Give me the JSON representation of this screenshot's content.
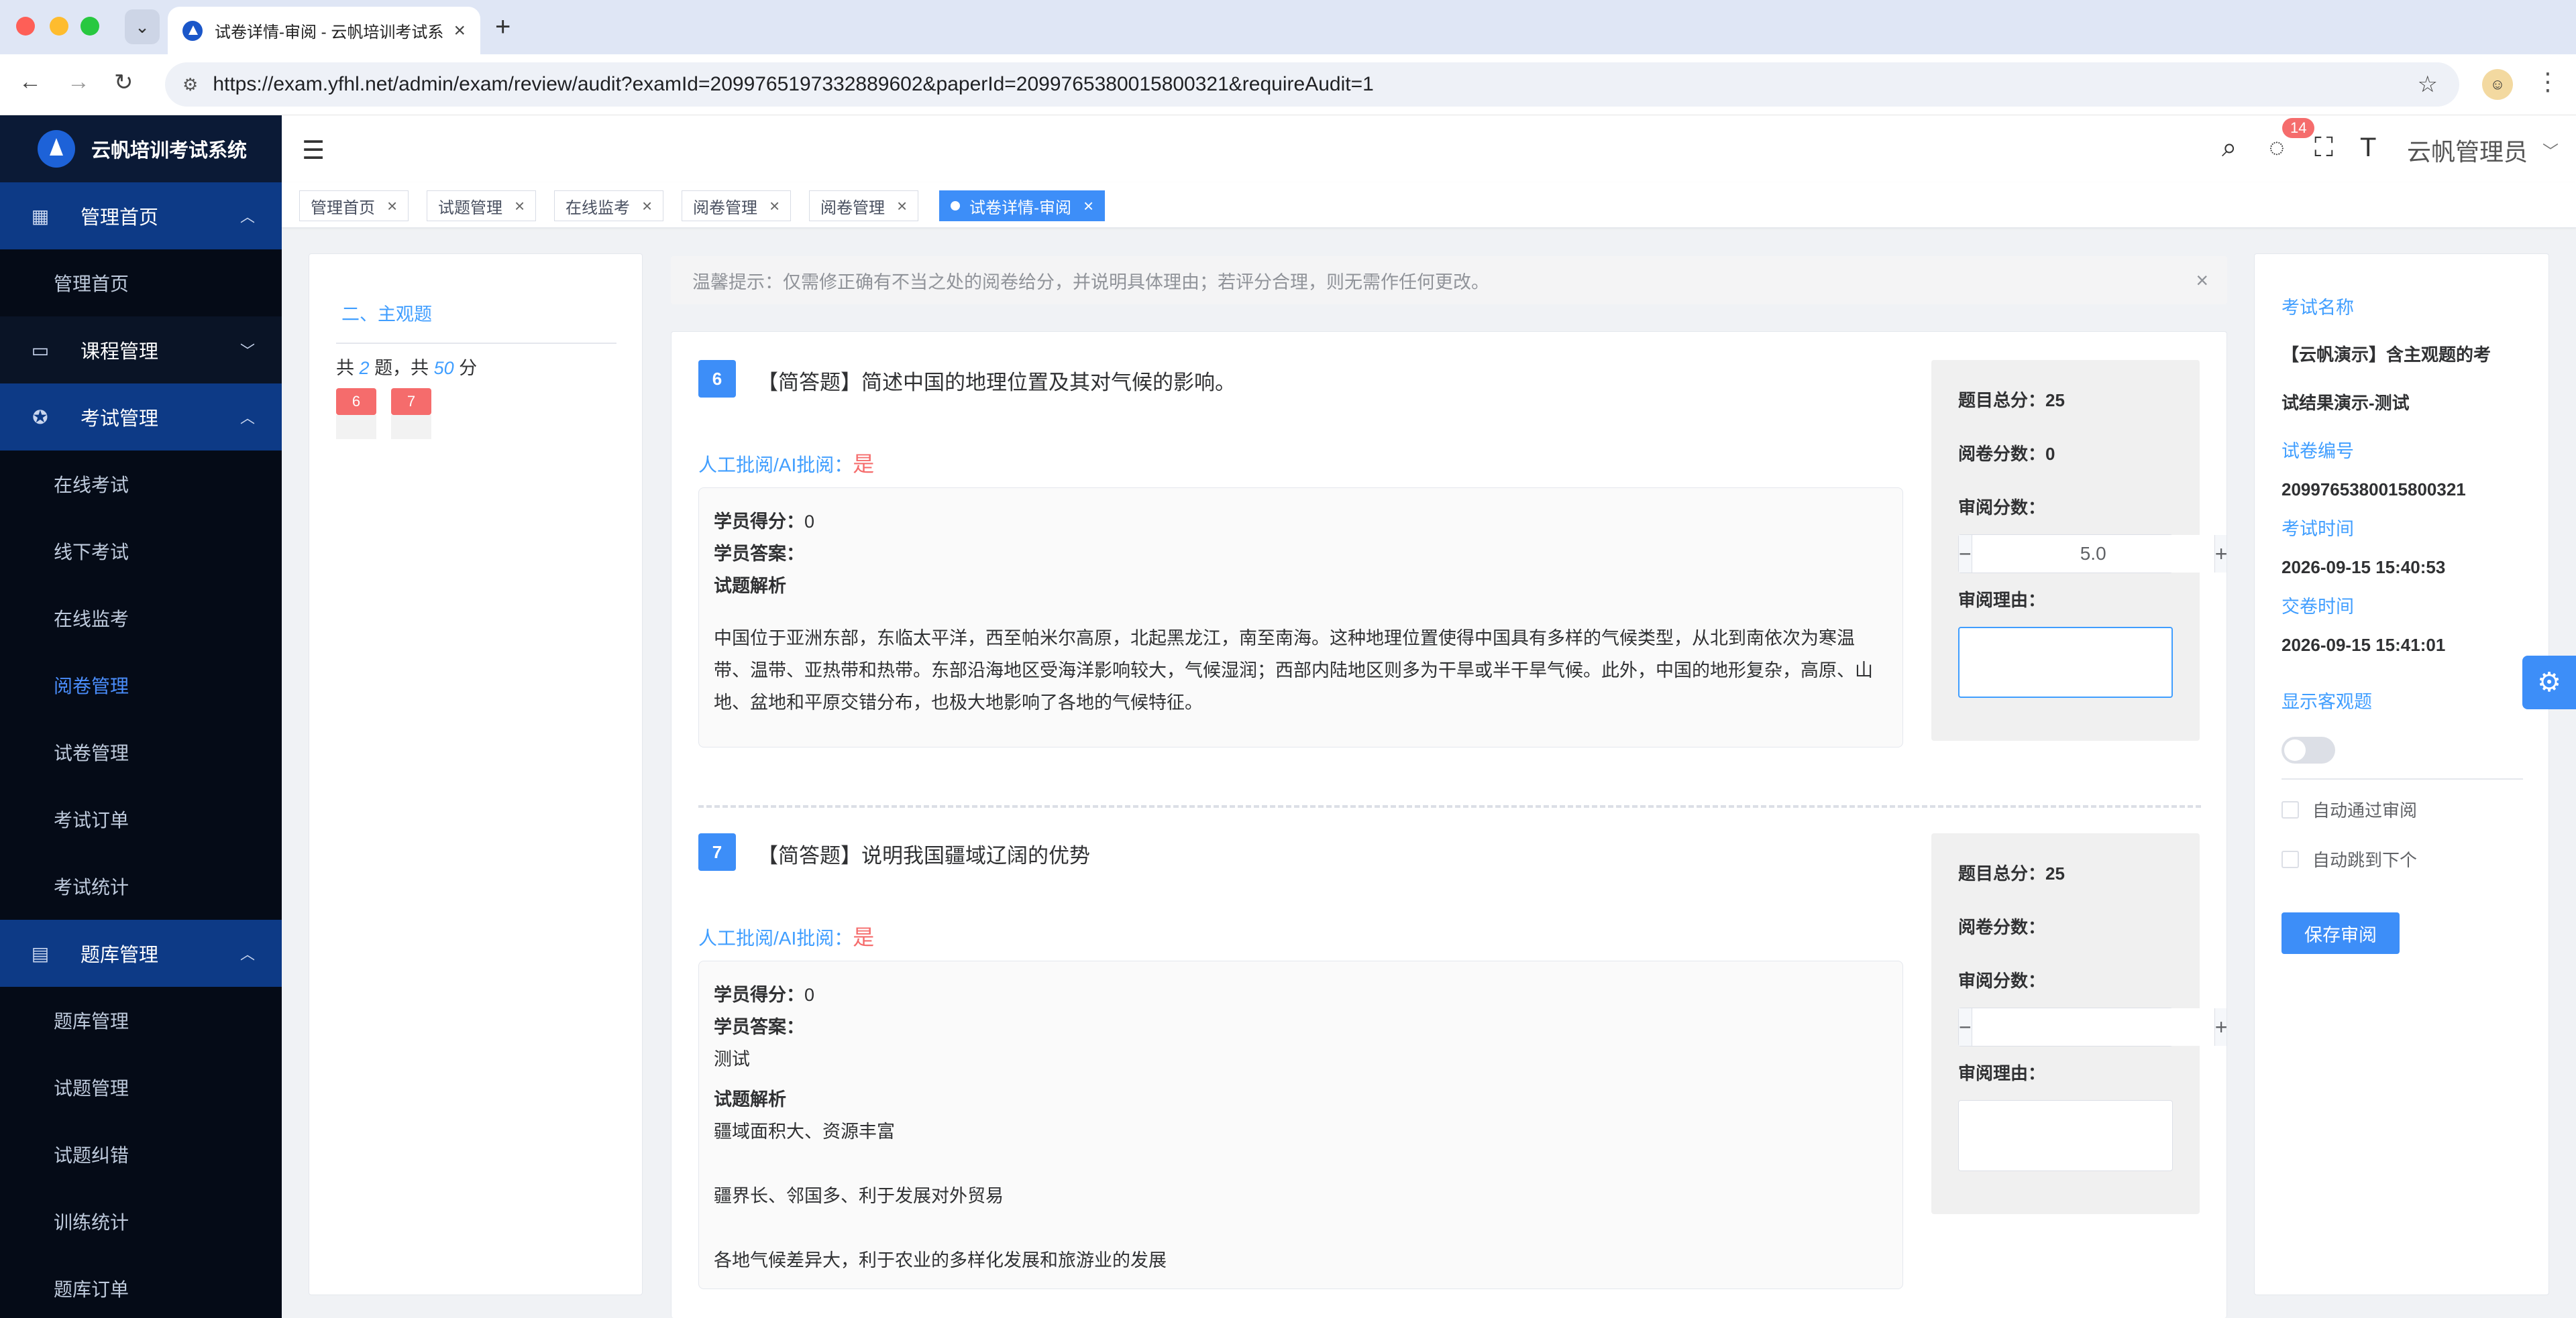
{
  "browser": {
    "tab_title": "试卷详情-审阅 - 云帆培训考试系",
    "url": "https://exam.yfhl.net/admin/exam/review/audit?examId=2099765197332889602&paperId=2099765380015800321&requireAudit=1"
  },
  "sidebar": {
    "logo_text": "云帆培训考试系统",
    "groups": [
      {
        "label": "管理首页",
        "items": [
          "管理首页"
        ]
      },
      {
        "label": "课程管理",
        "items": []
      },
      {
        "label": "考试管理",
        "items": [
          "在线考试",
          "线下考试",
          "在线监考",
          "阅卷管理",
          "试卷管理",
          "考试订单",
          "考试统计"
        ]
      },
      {
        "label": "题库管理",
        "items": [
          "题库管理",
          "试题管理",
          "试题纠错",
          "训练统计",
          "题库订单"
        ]
      }
    ]
  },
  "header": {
    "message_count": "14",
    "user_name": "云帆管理员"
  },
  "tags": [
    "管理首页",
    "试题管理",
    "在线监考",
    "阅卷管理",
    "阅卷管理",
    "试卷详情-审阅"
  ],
  "left_panel": {
    "section_title": "二、主观题",
    "summary_prefix": "共",
    "question_count": "2",
    "summary_mid": "题，共",
    "total_score": "50",
    "summary_suffix": "分",
    "chips": [
      "6",
      "7"
    ]
  },
  "tip": "温馨提示：仅需修正确有不当之处的阅卷给分，并说明具体理由；若评分合理，则无需作任何更改。",
  "questions": [
    {
      "number": "6",
      "title": "【简答题】简述中国的地理位置及其对气候的影响。",
      "mode_label": "人工批阅/AI批阅：",
      "mode_value": "是",
      "student_score_label": "学员得分：",
      "student_score": "0",
      "student_answer_label": "学员答案：",
      "student_answer": "",
      "analysis_label": "试题解析",
      "analysis": "中国位于亚洲东部，东临太平洋，西至帕米尔高原，北起黑龙江，南至南海。这种地理位置使得中国具有多样的气候类型，从北到南依次为寒温带、温带、亚热带和热带。东部沿海地区受海洋影响较大，气候湿润；西部内陆地区则多为干旱或半干旱气候。此外，中国的地形复杂，高原、山地、盆地和平原交错分布，也极大地影响了各地的气候特征。",
      "total_label": "题目总分：",
      "total": "25",
      "marked_label": "阅卷分数：",
      "marked": "0",
      "review_label": "审阅分数：",
      "review_value": "5.0",
      "reason_label": "审阅理由："
    },
    {
      "number": "7",
      "title": "【简答题】说明我国疆域辽阔的优势",
      "mode_label": "人工批阅/AI批阅：",
      "mode_value": "是",
      "student_score_label": "学员得分：",
      "student_score": "0",
      "student_answer_label": "学员答案：",
      "student_answer": "测试",
      "analysis_label": "试题解析",
      "analysis_lines": [
        "疆域面积大、资源丰富",
        "疆界长、邻国多、利于发展对外贸易",
        "各地气候差异大，利于农业的多样化发展和旅游业的发展"
      ],
      "total_label": "题目总分：",
      "total": "25",
      "marked_label": "阅卷分数：",
      "marked": "",
      "review_label": "审阅分数：",
      "review_value": "",
      "reason_label": "审阅理由："
    }
  ],
  "right_panel": {
    "exam_name_label": "考试名称",
    "exam_name_line1": "【云帆演示】含主观题的考",
    "exam_name_line2": "试结果演示-测试",
    "paper_no_label": "试卷编号",
    "paper_no": "2099765380015800321",
    "exam_time_label": "考试时间",
    "exam_time": "2026-09-15 15:40:53",
    "submit_time_label": "交卷时间",
    "submit_time": "2026-09-15 15:41:01",
    "show_objective_label": "显示客观题",
    "auto_pass_label": "自动通过审阅",
    "auto_next_label": "自动跳到下个",
    "save_label": "保存审阅"
  },
  "colors": {
    "accent": "#3d8ef8",
    "danger": "#f56c6c",
    "sidebar_bg": "#0a1426",
    "sidebar_active": "#0d3a86"
  }
}
